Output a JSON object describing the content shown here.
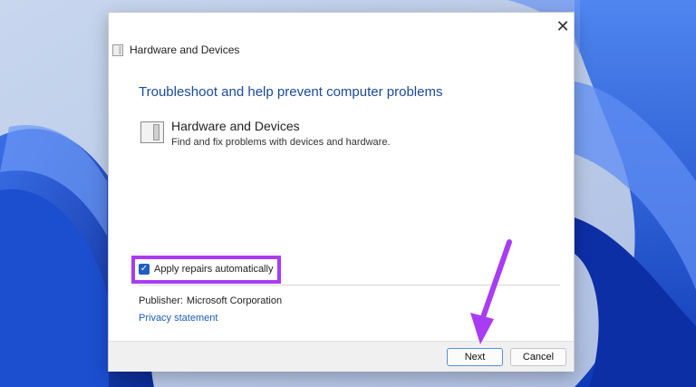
{
  "dialog": {
    "window_title": "Hardware and Devices",
    "close_glyph": "✕",
    "heading": "Troubleshoot and help prevent computer problems",
    "item": {
      "title": "Hardware and Devices",
      "description": "Find and fix problems with devices and hardware.",
      "icon": "hardware-device-icon"
    },
    "apply_repairs": {
      "label": "Apply repairs automatically",
      "checked": true
    },
    "publisher_label": "Publisher:",
    "publisher_value": "Microsoft Corporation",
    "privacy_link": "Privacy statement",
    "buttons": {
      "next": "Next",
      "cancel": "Cancel"
    }
  },
  "annotations": {
    "highlight_color": "#a93cf2",
    "arrow_color": "#a93cf2"
  },
  "colors": {
    "heading": "#1b4a9c",
    "link": "#1a5fb4",
    "checkbox": "#1f5fbf"
  }
}
